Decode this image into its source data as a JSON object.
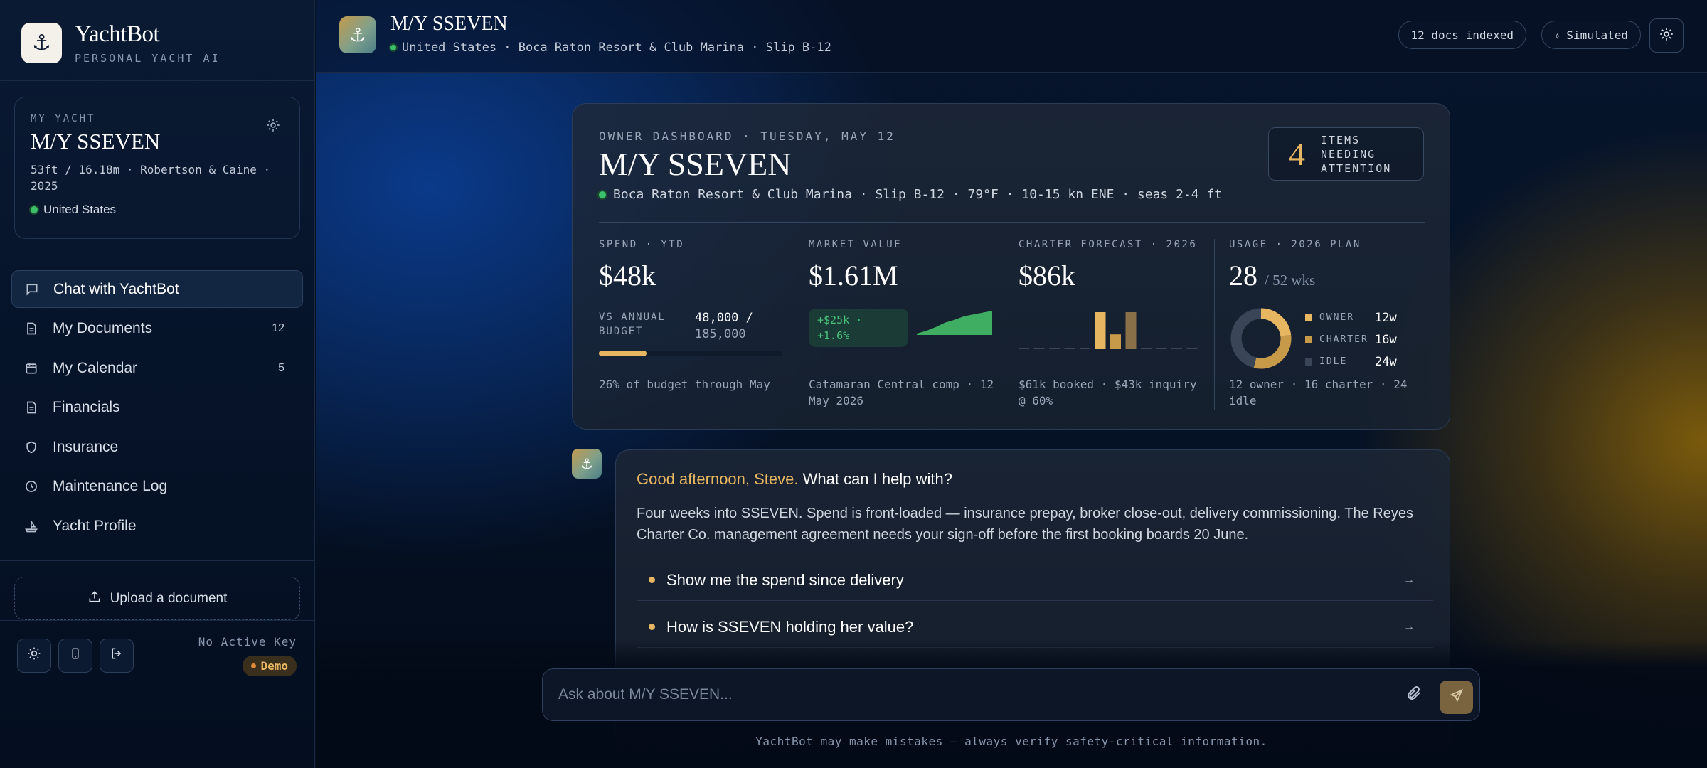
{
  "brand": {
    "name": "YachtBot",
    "subtitle": "PERSONAL YACHT AI"
  },
  "yacht_card": {
    "label": "MY YACHT",
    "name": "M/Y SSEVEN",
    "spec": "53ft / 16.18m · Robertson & Caine · 2025",
    "location": "United States"
  },
  "nav": [
    {
      "label": "Chat with YachtBot",
      "icon": "chat-icon",
      "active": true,
      "count": ""
    },
    {
      "label": "My Documents",
      "icon": "document-icon",
      "count": "12"
    },
    {
      "label": "My Calendar",
      "icon": "calendar-icon",
      "count": "5"
    },
    {
      "label": "Financials",
      "icon": "document-icon",
      "count": ""
    },
    {
      "label": "Insurance",
      "icon": "shield-icon",
      "count": ""
    },
    {
      "label": "Maintenance Log",
      "icon": "clock-icon",
      "count": ""
    },
    {
      "label": "Yacht Profile",
      "icon": "boat-icon",
      "count": ""
    }
  ],
  "upload_label": "Upload a document",
  "key_status": "No Active Key",
  "demo_label": "Demo",
  "topbar": {
    "title": "M/Y SSEVEN",
    "subtitle": "United States · Boca Raton Resort & Club Marina · Slip B-12",
    "docs_pill": "12 docs indexed",
    "mode_pill": "Simulated"
  },
  "dashboard": {
    "label": "OWNER DASHBOARD · TUESDAY, MAY 12",
    "title": "M/Y SSEVEN",
    "location_line": "Boca Raton Resort & Club Marina · Slip B-12 · 79°F · 10-15 kn ENE · seas 2-4 ft",
    "attention_count": "4",
    "attention_label": "ITEMS NEEDING ATTENTION",
    "spend": {
      "label": "SPEND · YTD",
      "value": "$48k",
      "budget_label": "VS ANNUAL BUDGET",
      "budget_spent": "48,000 /",
      "budget_total": "185,000",
      "progress": 0.26,
      "footnote": "26% of budget through May"
    },
    "market": {
      "label": "MARKET VALUE",
      "value": "$1.61M",
      "change_line1": "+$25k ·",
      "change_line2": "+1.6%",
      "footnote": "Catamaran Central comp · 12 May 2026"
    },
    "charter": {
      "label": "CHARTER FORECAST · 2026",
      "value": "$86k",
      "footnote": "$61k booked · $43k inquiry @ 60%"
    },
    "usage": {
      "label": "USAGE · 2026 PLAN",
      "value": "28",
      "value_suffix": "/ 52 wks",
      "legend": [
        {
          "name": "OWNER",
          "value": "12w",
          "color": "#e7b660"
        },
        {
          "name": "CHARTER",
          "value": "16w",
          "color": "#c79a4a"
        },
        {
          "name": "IDLE",
          "value": "24w",
          "color": "#3a4658"
        }
      ],
      "footnote": "12 owner · 16 charter · 24 idle"
    }
  },
  "chart_data": [
    {
      "type": "area",
      "title": "",
      "series": [
        {
          "values": [
            1.585,
            1.588,
            1.592,
            1.597,
            1.6,
            1.604,
            1.606,
            1.608,
            1.61
          ]
        }
      ],
      "color": "#3fae62"
    },
    {
      "type": "bar",
      "title": "",
      "categories": [
        "1",
        "2",
        "3",
        "4",
        "5",
        "6",
        "7",
        "8",
        "9",
        "10",
        "11",
        "12"
      ],
      "values": [
        0,
        0,
        0,
        0,
        0,
        1.0,
        0.4,
        1.0,
        0,
        0,
        0,
        0
      ],
      "colors": [
        "#e7b660",
        "#c79a4a",
        "#8a7048"
      ]
    },
    {
      "type": "pie",
      "title": "",
      "categories": [
        "OWNER",
        "CHARTER",
        "IDLE"
      ],
      "values": [
        12,
        16,
        24
      ],
      "colors": [
        "#e7b660",
        "#c79a4a",
        "#3a4658"
      ]
    }
  ],
  "message": {
    "greeting_highlight": "Good afternoon, Steve.",
    "greeting_rest": " What can I help with?",
    "body": "Four weeks into SSEVEN. Spend is front-loaded — insurance prepay, broker close-out, delivery commissioning. The Reyes Charter Co. management agreement needs your sign-off before the first booking boards 20 June.",
    "suggestions": [
      "Show me the spend since delivery",
      "How is SSEVEN holding her value?"
    ]
  },
  "input": {
    "placeholder": "Ask about M/Y SSEVEN..."
  },
  "disclaimer": "YachtBot may make mistakes — always verify safety-critical information."
}
